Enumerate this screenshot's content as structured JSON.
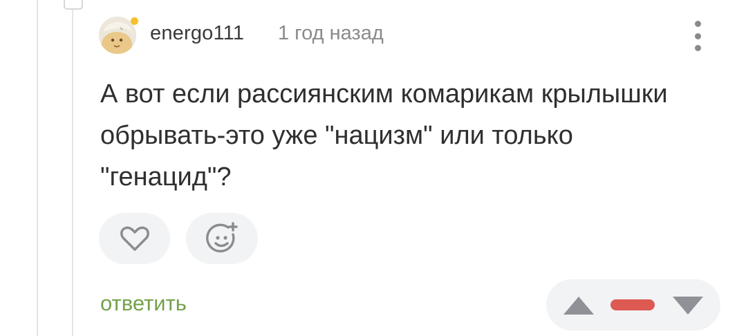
{
  "comment": {
    "author": "energo111",
    "time": "1 год назад",
    "text": "А вот если рассиянским комарикам крылышки обрывать-это уже \"нацизм\" или только \"генацид\"?",
    "reply_label": "ответить"
  },
  "colors": {
    "accent_green": "#74a14c",
    "rating_negative": "#dd5a52",
    "online_indicator": "#f6c02a"
  },
  "icons": {
    "like": "heart-icon",
    "reaction": "smile-add-icon",
    "more": "more-vertical-icon",
    "upvote": "triangle-up-icon",
    "downvote": "triangle-down-icon"
  },
  "rating": {
    "state": "negative"
  }
}
